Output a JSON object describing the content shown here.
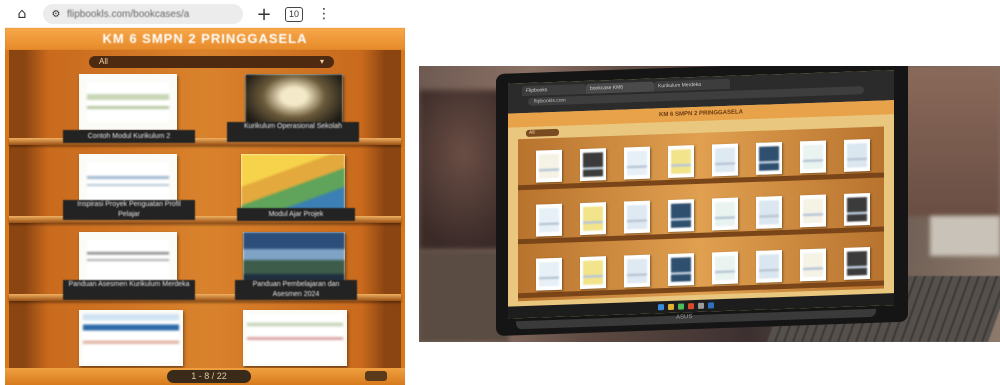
{
  "phone": {
    "browser": {
      "url": "flipbookls.com/bookcases/a",
      "tab_count": "10",
      "new_tab": "+",
      "home_icon": "home-icon",
      "lock_icon": "tune-icon",
      "menu_icon": "more-vertical-icon"
    },
    "header_title": "KM 6 SMPN 2 PRINGGASELA",
    "filter": {
      "label": "All",
      "icon": "chevron-down-icon"
    },
    "books": [
      {
        "label": "Contoh Modul Kurikulum 2",
        "cover": "document-cover"
      },
      {
        "label": "Kurikulum Operasional Sekolah",
        "cover": "dark-photo-cover"
      },
      {
        "label": "Inspirasi Proyek Penguatan Profil Pelajar",
        "cover": "document-cover"
      },
      {
        "label": "Modul Ajar Projek",
        "cover": "colorful-cover"
      },
      {
        "label": "Panduan Asesmen Kurikulum Merdeka",
        "cover": "document-cover"
      },
      {
        "label": "Panduan Pembelajaran dan Asesmen 2024",
        "cover": "landscape-cover"
      },
      {
        "label": "",
        "cover": "title-document-cover"
      },
      {
        "label": "",
        "cover": "document-cover"
      }
    ],
    "pager": {
      "text": "1 - 8 / 22"
    }
  },
  "laptop": {
    "tabs": [
      "Flipbooks",
      "bookcase KM6",
      "Kurikulum Merdeka"
    ],
    "address": "flipbookls.com",
    "header_title": "KM 6 SMPN 2 PRINGGASELA",
    "filter": "All",
    "brand": "ASUS",
    "book_rows": 3,
    "books_per_row": 8
  },
  "colors": {
    "bookcase_orange": "#d9822c",
    "shelf_dark": "#8b4512",
    "label_bg": "#232323",
    "header_orange": "#e68a2a"
  }
}
